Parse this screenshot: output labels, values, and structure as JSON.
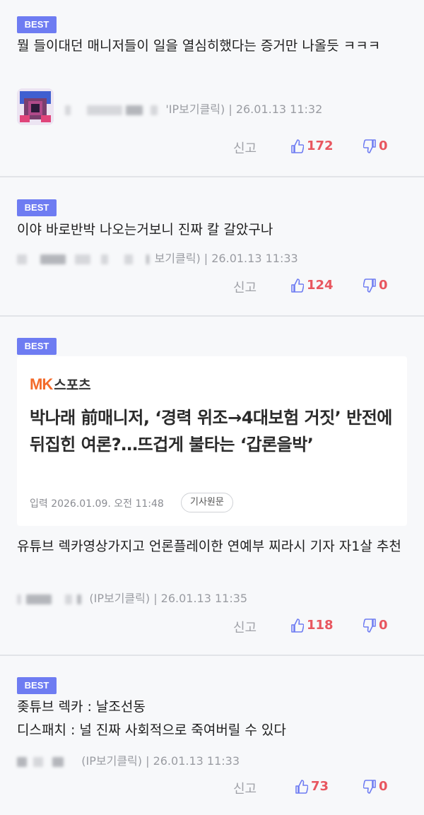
{
  "badge_label": "BEST",
  "report_label": "신고",
  "comments": [
    {
      "text": "뭘 들이대던 매니저들이 일을 열심히했다는 증거만 나올듯 ㅋㅋㅋ",
      "meta": "'IP보기클릭) | 26.01.13 11:32",
      "likes": "172",
      "dislikes": "0"
    },
    {
      "text": "이야 바로반박 나오는거보니 진짜 칼 갈았구나",
      "meta": "보기클릭) | 26.01.13 11:33",
      "likes": "124",
      "dislikes": "0"
    },
    {
      "text": "유튜브 렉카영상가지고 언론플레이한 연예부 찌라시 기자 자1살 추천",
      "meta": "(IP보기클릭) | 26.01.13 11:35",
      "likes": "118",
      "dislikes": "0"
    },
    {
      "text_line1": "좆튜브 렉카 : 날조선동",
      "text_line2": "디스패치 : 널 진짜 사회적으로 죽여버릴 수 있다",
      "meta": "(IP보기클릭) | 26.01.13 11:33",
      "likes": "73",
      "dislikes": "0"
    }
  ],
  "article": {
    "logo_mk": "MK",
    "logo_sports": "스포츠",
    "title": "박나래 前매니저, ‘경력 위조→4대보험 거짓’ 반전에 뒤집힌 여론?…뜨겁게 불타는 ‘갑론을박’",
    "date": "입력 2026.01.09. 오전 11:48",
    "source_button": "기사원문"
  },
  "colors": {
    "badge": "#6e7cf2",
    "vote": "#e8565f",
    "thumb_up": "#6e7cf2",
    "thumb_down": "#6e7cf2",
    "mk_logo": "#f36a2a"
  }
}
